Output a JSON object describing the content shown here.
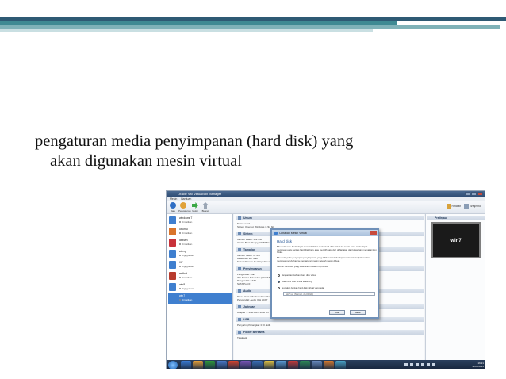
{
  "slide": {
    "caption_line1": "pengaturan media penyimpanan (hard disk) yang",
    "caption_line2": "akan digunakan mesin virtual",
    "band_colors": [
      "#2f5a74",
      "#3f8a93",
      "#7fb2b8",
      "#c9dfe2"
    ]
  },
  "screenshot": {
    "window_title": "Oracle VM VirtualBox Manager",
    "menu": [
      "Mesin",
      "Bantuan"
    ],
    "toolbar": [
      {
        "label": "Baru",
        "color": "#2f6ec4"
      },
      {
        "label": "Pengaturan",
        "color": "#e0a23a"
      },
      {
        "label": "Mulai",
        "color": "#3aa845"
      },
      {
        "label": "Buang",
        "color": "#9aa6b5"
      }
    ],
    "toolbar_right": [
      "Rincian",
      "Snapshot"
    ],
    "vm_list": [
      {
        "name": "windows 7",
        "state": "Dimatikan",
        "color": "#3f7fcf",
        "selected": false
      },
      {
        "name": "ubuntu",
        "state": "Dimatikan",
        "color": "#d9742b",
        "selected": false
      },
      {
        "name": "debian",
        "state": "Dimatikan",
        "color": "#c8323a",
        "selected": false
      },
      {
        "name": "winxp",
        "state": "Digugurkan",
        "color": "#3f7fcf",
        "selected": false
      },
      {
        "name": "XP",
        "state": "Digugurkan",
        "color": "#3f7fcf",
        "selected": false
      },
      {
        "name": "redhat",
        "state": "Dimatikan",
        "color": "#b83b2e",
        "selected": false
      },
      {
        "name": "win8",
        "state": "Digugurkan",
        "color": "#3f7fcf",
        "selected": false
      },
      {
        "name": "win7",
        "state": "Dimatikan",
        "color": "#3f7fcf",
        "selected": true
      }
    ],
    "details": {
      "general_header": "Umum",
      "general_lines": [
        "Nama: win7",
        "Sistem Operasi: Windows 7 (32 bit)"
      ],
      "system_header": "Sistem",
      "system_lines": [
        "Memori Dasar: 512 MB",
        "Urutan Boot: Floppy, CD/DVD-ROM, Hard Disk"
      ],
      "display_header": "Tampilan",
      "display_lines": [
        "Memori Video: 12 MB",
        "Akselerasi 3D: Mati",
        "Server Remote Desktop: Dinonaktifkan"
      ],
      "storage_header": "Penyimpanan",
      "storage_lines": [
        "Pengendali: IDE",
        "IDE Master Sekunder: [CD/DVD] Kosong",
        "Pengendali: SATA",
        "SATA Port 0:"
      ],
      "audio_header": "Audio",
      "audio_lines": [
        "Driver Host: Windows DirectSound",
        "Pengendali: Audio ICH AC97"
      ],
      "network_header": "Jaringan",
      "network_lines": [
        "Adapter 1: Intel PRO/1000 MT Desktop (NAT)"
      ],
      "usb_header": "USB",
      "usb_lines": [
        "Penyaring Perangkat: 0 (0 aktif)"
      ],
      "shared_header": "Folder Bersama",
      "shared_lines": [
        "Tidak ada"
      ]
    },
    "preview": {
      "header": "Pratinjau",
      "screen_text": "win7"
    },
    "dialog": {
      "title": "Ciptakan Mesin Virtual",
      "heading": "Hard disk",
      "para1": "Bila Anda mau Anda dapat menambahkan suatu hard disk virtual ke mesin baru. Anda dapat membuat suatu berkas hard disk baru atau memilih satu dari daftar atau dari lokasi lain memakai ikon folder.",
      "para2": "Bila Anda perlu penyiapan penyimpanan yang lebih rumit Anda dapat melewati langkah ini dan membuat perubahan ke pengaturan mesin setelah mesin dibuat.",
      "para3": "Ukuran hard disk yang disarankan adalah 25,00 GB.",
      "options": [
        {
          "label": "Jangan tambahkan hard disk virtual",
          "on": false
        },
        {
          "label": "Buat hard disk virtual sekarang",
          "on": true
        },
        {
          "label": "Gunakan berkas hard disk virtual yang ada",
          "on": false
        }
      ],
      "combo_value": "win7.vdi (Normal, 25,00 GB)",
      "btn_create": "Buat",
      "btn_cancel": "Batal"
    },
    "taskbar": {
      "time": "16:21",
      "date": "11/01/2015",
      "apps": [
        "#3a7bd5",
        "#e8a13a",
        "#2f9a3a",
        "#4a78c8",
        "#d8442e",
        "#7a54b8",
        "#3b6fb8",
        "#e0c243",
        "#5b9bd5",
        "#c43b3b",
        "#2e8b57",
        "#6a8bbf",
        "#d77a2f",
        "#4aa3c7"
      ]
    }
  }
}
